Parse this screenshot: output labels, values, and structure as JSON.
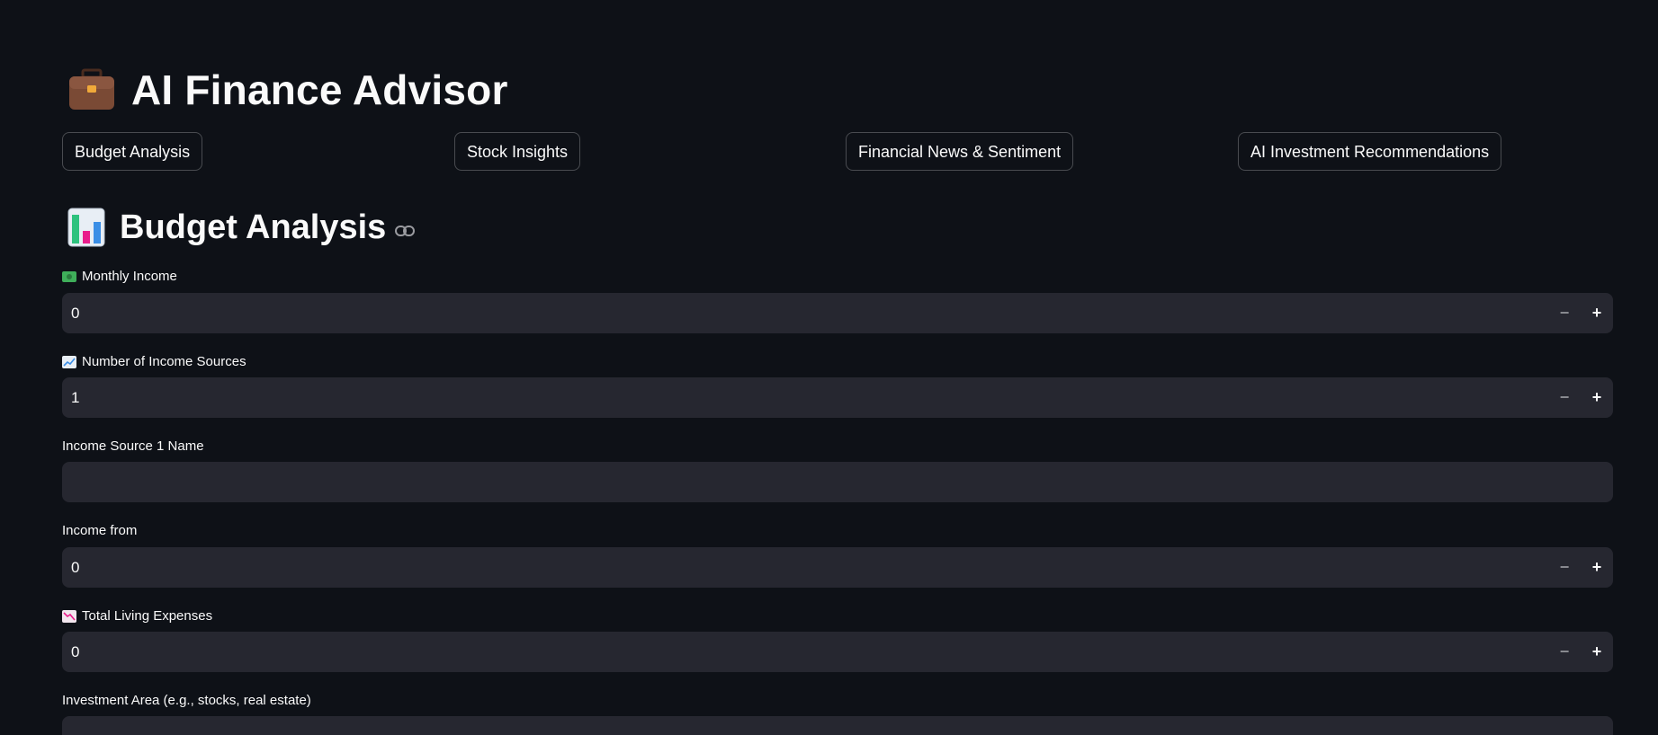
{
  "app": {
    "title": "AI Finance Advisor",
    "title_icon": "briefcase-icon"
  },
  "tabs": [
    {
      "label": "Budget Analysis"
    },
    {
      "label": "Stock Insights"
    },
    {
      "label": "Financial News & Sentiment"
    },
    {
      "label": "AI Investment Recommendations"
    }
  ],
  "section": {
    "title": "Budget Analysis",
    "icon": "bar-chart-icon",
    "anchor_icon": "link-icon"
  },
  "fields": {
    "monthly_income": {
      "label": "Monthly Income",
      "icon": "money-icon",
      "value": "0",
      "minus": "−",
      "plus": "+"
    },
    "income_sources": {
      "label": "Number of Income Sources",
      "icon": "chart-increasing-icon",
      "value": "1",
      "minus": "−",
      "plus": "+"
    },
    "source_1_name": {
      "label": "Income Source 1 Name",
      "value": ""
    },
    "income_from": {
      "label": "Income from",
      "value": "0",
      "minus": "−",
      "plus": "+"
    },
    "living_expenses": {
      "label": "Total Living Expenses",
      "icon": "chart-decreasing-icon",
      "value": "0",
      "minus": "−",
      "plus": "+"
    },
    "investment_area": {
      "label": "Investment Area (e.g., stocks, real estate)",
      "value": ""
    }
  },
  "colors": {
    "background": "#0e1117",
    "input_background": "#262730",
    "text": "#fafafa"
  }
}
